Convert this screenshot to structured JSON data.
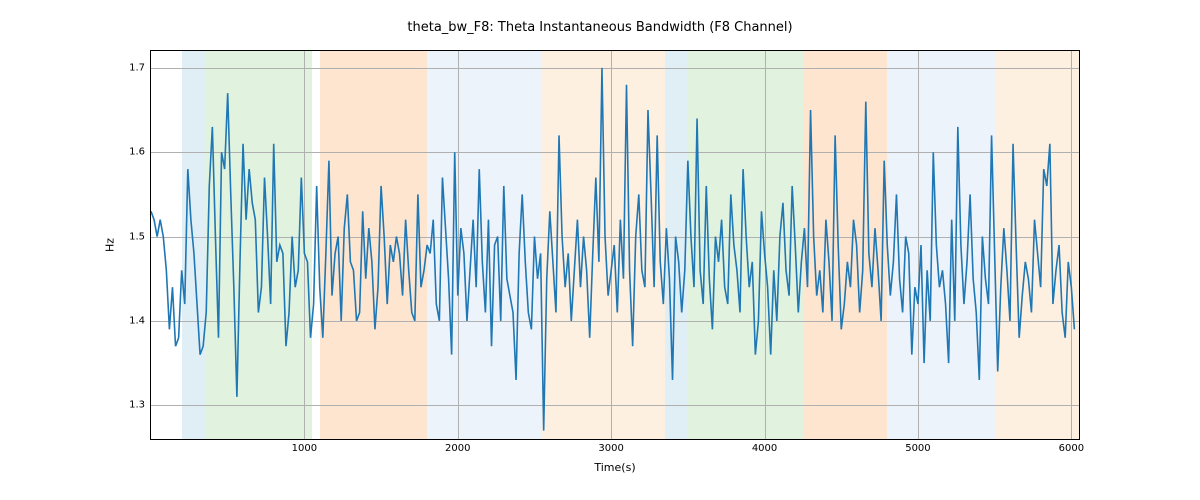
{
  "chart_data": {
    "type": "line",
    "title": "theta_bw_F8: Theta Instantaneous Bandwidth (F8 Channel)",
    "xlabel": "Time(s)",
    "ylabel": "Hz",
    "xlim": [
      0,
      6050
    ],
    "ylim": [
      1.26,
      1.72
    ],
    "yticks": [
      1.3,
      1.4,
      1.5,
      1.6,
      1.7
    ],
    "xticks": [
      1000,
      2000,
      3000,
      4000,
      5000,
      6000
    ],
    "regions": [
      {
        "start": 200,
        "end": 350,
        "color": "#9ecae1"
      },
      {
        "start": 350,
        "end": 1050,
        "color": "#a1d99b"
      },
      {
        "start": 1100,
        "end": 1800,
        "color": "#fdae6b"
      },
      {
        "start": 1800,
        "end": 2550,
        "color": "#c6dbef"
      },
      {
        "start": 2550,
        "end": 3350,
        "color": "#fdd0a2"
      },
      {
        "start": 3350,
        "end": 3500,
        "color": "#9ecae1"
      },
      {
        "start": 3500,
        "end": 4250,
        "color": "#a1d99b"
      },
      {
        "start": 4250,
        "end": 4800,
        "color": "#fdae6b"
      },
      {
        "start": 4800,
        "end": 5500,
        "color": "#c6dbef"
      },
      {
        "start": 5500,
        "end": 6050,
        "color": "#fdd0a2"
      }
    ],
    "series": [
      {
        "name": "theta_bw_F8",
        "color": "#1f77b4",
        "x_step": 20,
        "values": [
          1.53,
          1.52,
          1.5,
          1.52,
          1.5,
          1.46,
          1.39,
          1.44,
          1.37,
          1.38,
          1.46,
          1.42,
          1.58,
          1.52,
          1.48,
          1.42,
          1.36,
          1.37,
          1.41,
          1.56,
          1.63,
          1.5,
          1.38,
          1.6,
          1.58,
          1.67,
          1.55,
          1.44,
          1.31,
          1.47,
          1.61,
          1.52,
          1.58,
          1.54,
          1.52,
          1.41,
          1.44,
          1.57,
          1.5,
          1.42,
          1.61,
          1.47,
          1.49,
          1.48,
          1.37,
          1.41,
          1.5,
          1.44,
          1.46,
          1.57,
          1.48,
          1.47,
          1.38,
          1.42,
          1.56,
          1.44,
          1.38,
          1.48,
          1.59,
          1.43,
          1.48,
          1.5,
          1.4,
          1.51,
          1.55,
          1.47,
          1.46,
          1.4,
          1.41,
          1.53,
          1.45,
          1.51,
          1.47,
          1.39,
          1.44,
          1.56,
          1.5,
          1.42,
          1.49,
          1.47,
          1.5,
          1.48,
          1.43,
          1.52,
          1.46,
          1.41,
          1.4,
          1.55,
          1.44,
          1.46,
          1.49,
          1.48,
          1.52,
          1.42,
          1.4,
          1.57,
          1.51,
          1.45,
          1.36,
          1.6,
          1.43,
          1.51,
          1.48,
          1.4,
          1.46,
          1.52,
          1.44,
          1.58,
          1.47,
          1.41,
          1.52,
          1.37,
          1.49,
          1.5,
          1.4,
          1.56,
          1.45,
          1.43,
          1.41,
          1.33,
          1.48,
          1.55,
          1.47,
          1.41,
          1.39,
          1.5,
          1.45,
          1.48,
          1.27,
          1.45,
          1.53,
          1.47,
          1.41,
          1.62,
          1.5,
          1.44,
          1.48,
          1.4,
          1.46,
          1.52,
          1.44,
          1.5,
          1.46,
          1.38,
          1.48,
          1.57,
          1.47,
          1.7,
          1.5,
          1.43,
          1.46,
          1.49,
          1.41,
          1.52,
          1.45,
          1.68,
          1.46,
          1.37,
          1.5,
          1.55,
          1.46,
          1.44,
          1.65,
          1.55,
          1.44,
          1.62,
          1.47,
          1.42,
          1.51,
          1.45,
          1.33,
          1.5,
          1.47,
          1.41,
          1.46,
          1.59,
          1.5,
          1.44,
          1.64,
          1.46,
          1.42,
          1.56,
          1.45,
          1.39,
          1.5,
          1.47,
          1.52,
          1.44,
          1.42,
          1.55,
          1.49,
          1.46,
          1.41,
          1.58,
          1.5,
          1.44,
          1.47,
          1.36,
          1.4,
          1.53,
          1.48,
          1.44,
          1.36,
          1.46,
          1.4,
          1.5,
          1.54,
          1.46,
          1.43,
          1.56,
          1.49,
          1.41,
          1.47,
          1.51,
          1.44,
          1.65,
          1.5,
          1.43,
          1.46,
          1.41,
          1.52,
          1.47,
          1.4,
          1.62,
          1.49,
          1.39,
          1.42,
          1.47,
          1.44,
          1.52,
          1.49,
          1.41,
          1.46,
          1.66,
          1.48,
          1.44,
          1.51,
          1.46,
          1.4,
          1.59,
          1.49,
          1.43,
          1.47,
          1.55,
          1.45,
          1.41,
          1.5,
          1.48,
          1.36,
          1.44,
          1.42,
          1.49,
          1.35,
          1.46,
          1.4,
          1.6,
          1.49,
          1.44,
          1.46,
          1.42,
          1.35,
          1.52,
          1.4,
          1.63,
          1.49,
          1.42,
          1.47,
          1.55,
          1.45,
          1.41,
          1.33,
          1.5,
          1.45,
          1.42,
          1.62,
          1.48,
          1.34,
          1.44,
          1.51,
          1.46,
          1.4,
          1.61,
          1.49,
          1.38,
          1.43,
          1.47,
          1.45,
          1.41,
          1.52,
          1.48,
          1.44,
          1.58,
          1.56,
          1.61,
          1.42,
          1.46,
          1.49,
          1.41,
          1.38,
          1.47,
          1.44,
          1.39
        ]
      }
    ]
  }
}
